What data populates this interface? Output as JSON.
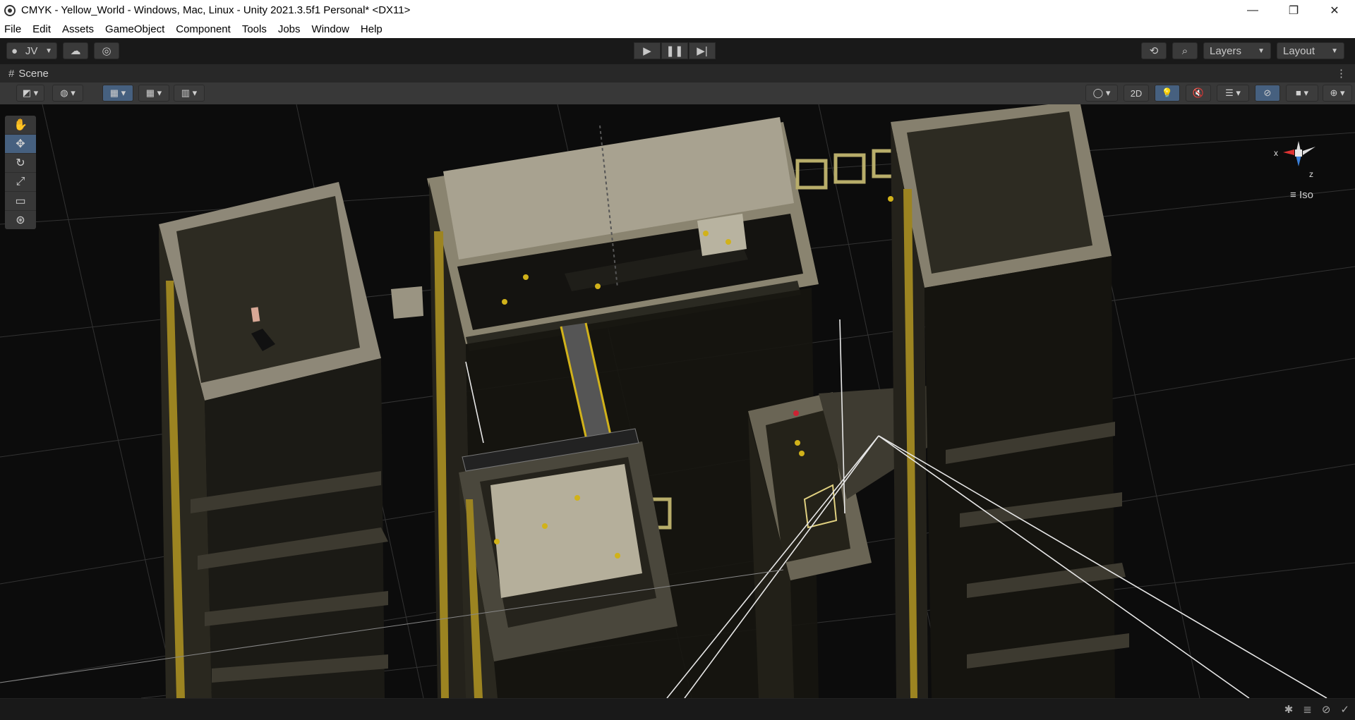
{
  "window": {
    "title": "CMYK - Yellow_World - Windows, Mac, Linux - Unity 2021.3.5f1 Personal* <DX11>",
    "controls": {
      "minimize": "—",
      "restore": "❐",
      "close": "✕"
    }
  },
  "menu": [
    "File",
    "Edit",
    "Assets",
    "GameObject",
    "Component",
    "Tools",
    "Jobs",
    "Window",
    "Help"
  ],
  "toolbar": {
    "account": "JV",
    "account_icon": "user-icon",
    "cloud_icon": "cloud-icon",
    "collab_icon": "collab-icon",
    "play_icon": "play-icon",
    "pause_icon": "pause-icon",
    "step_icon": "step-icon",
    "history_icon": "history-icon",
    "search_icon": "search-icon",
    "layers": "Layers",
    "layout": "Layout"
  },
  "scene_tab": {
    "label": "Scene"
  },
  "scene_toolbar": {
    "mode_2d": "2D"
  },
  "gizmo": {
    "x_label": "x",
    "z_label": "z",
    "projection": "Iso"
  },
  "colors": {
    "accent": "#46607f",
    "building_top": "#a69f8c",
    "building_dark": "#3b382e",
    "yellow": "#d1b21a",
    "grid": "#3a3a3a"
  }
}
